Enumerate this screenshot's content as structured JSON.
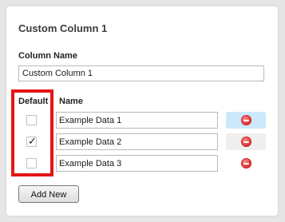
{
  "card": {
    "title": "Custom Column 1",
    "column_name_label": "Column Name",
    "column_name_value": "Custom Column 1"
  },
  "table": {
    "headers": {
      "default": "Default",
      "name": "Name"
    },
    "rows": [
      {
        "value": "Example Data 1",
        "default_checked": false,
        "delete_state": "hover"
      },
      {
        "value": "Example Data 2",
        "default_checked": true,
        "delete_state": "pressed"
      },
      {
        "value": "Example Data 3",
        "default_checked": false,
        "delete_state": "normal"
      }
    ]
  },
  "icons": {
    "checkbox_check": "✓",
    "delete": "remove-circle-icon"
  },
  "add_button_label": "Add New",
  "colors": {
    "highlight": "#e51616",
    "delete_icon": "#e23b3b",
    "hover_bg": "#cde8fb"
  }
}
